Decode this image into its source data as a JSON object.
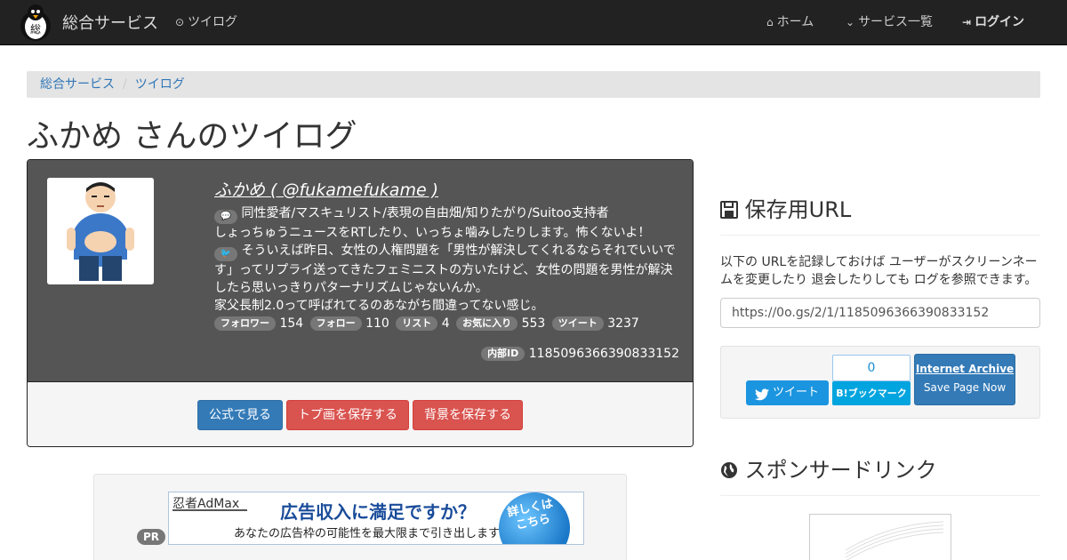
{
  "nav": {
    "brand": "総合サービス",
    "brand_logo_char": "総",
    "service_link": "ツイログ",
    "home": "ホーム",
    "services": "サービス一覧",
    "login": "ログイン"
  },
  "breadcrumb": [
    "総合サービス",
    "ツイログ"
  ],
  "page_title": "ふかめ さんのツイログ",
  "profile": {
    "name": "ふかめ ( @fukamefukame )",
    "bio_line1": "同性愛者/マスキュリスト/表現の自由畑/知りたがり/Suitoo支持者",
    "bio_line2": "しょっちゅうニュースをRTしたり、いっちょ噛みしたりします。怖くないよ！",
    "tweet_text": "そういえば昨日、女性の人権問題を「男性が解決してくれるならそれでいいです」ってリプライ送ってきたフェミニストの方いたけど、女性の問題を男性が解決したら思いっきりパターナリズムじゃないんか。",
    "tweet_text2": "家父長制2.0って呼ばれてるのあながち間違ってない感じ。",
    "stats": [
      {
        "label": "フォロワー",
        "value": "154"
      },
      {
        "label": "フォロー",
        "value": "110"
      },
      {
        "label": "リスト",
        "value": "4"
      },
      {
        "label": "お気に入り",
        "value": "553"
      },
      {
        "label": "ツイート",
        "value": "3237"
      }
    ],
    "internal_id_label": "内部ID",
    "internal_id": "1185096366390833152"
  },
  "actions": {
    "official": "公式で見る",
    "save_top": "トプ画を保存する",
    "save_bg": "背景を保存する"
  },
  "ad": {
    "pr": "PR",
    "brand": "忍者AdMax",
    "headline": "広告収入に満足ですか？",
    "sub": "あなたの広告枠の可能性を最大限まで引き出します",
    "cta_line1": "詳しくは",
    "cta_line2": "こちら"
  },
  "sidebar": {
    "save_heading": "保存用URL",
    "save_desc": "以下の URLを記録しておけば ユーザーがスクリーンネームを変更したり 退会したりしても ログを参照できます。",
    "url": "https://0o.gs/2/1/1185096366390833152",
    "tweet_btn": "ツイート",
    "hatena_count": "0",
    "hatena_btn": "B!ブックマーク",
    "ia_title": "Internet Archive",
    "ia_sub": "Save Page Now",
    "sponsor_heading": "スポンサードリンク"
  },
  "colors": {
    "navbar": "#222222",
    "card_top": "#555555",
    "primary": "#337ab7",
    "danger": "#d9534f",
    "twitter": "#1b95e0",
    "hatena": "#00a4de"
  }
}
